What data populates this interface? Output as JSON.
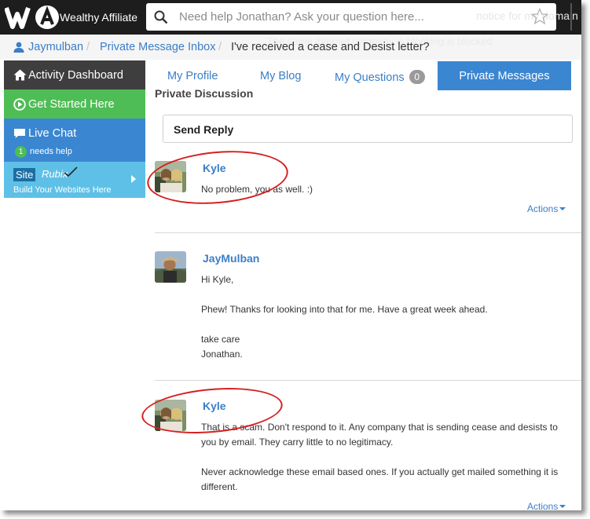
{
  "topbar": {
    "brand": "Wealthy Affiliate",
    "search_placeholder": "Need help Jonathan? Ask your question here...",
    "ghost_text": "notice for my domain"
  },
  "breadcrumb": {
    "user": "Jaymulban",
    "separator": "/",
    "inbox": "Private Message Inbox",
    "current": "I've received a cease and Desist letter?",
    "ghost_text": "The same internet company is blocking is blocked"
  },
  "sidebar": {
    "items": [
      {
        "label": "Activity Dashboard",
        "icon": "home-icon",
        "color": "#3e3e3e"
      },
      {
        "label": "Get Started Here",
        "icon": "play-circle-icon",
        "color": "#4fbd55"
      },
      {
        "label": "Live Chat",
        "icon": "chat-icon",
        "color": "#3b86d1",
        "badge": "1",
        "sub": "needs help"
      },
      {
        "label_box": "Site",
        "label_text": "Rubix",
        "sub": "Build Your Websites Here",
        "color": "#5ec0e6"
      }
    ]
  },
  "tabs": [
    {
      "label": "My Profile"
    },
    {
      "label": "My Blog"
    },
    {
      "label": "My Questions",
      "badge": "0"
    },
    {
      "label": "Private Messages",
      "active": true
    }
  ],
  "main": {
    "section_title": "Private Discussion",
    "reply_label": "Send Reply",
    "actions_label": "Actions",
    "messages": [
      {
        "author": "Kyle",
        "lines": [
          "No problem, you as well. :)"
        ]
      },
      {
        "author": "JayMulban",
        "lines": [
          "Hi Kyle,",
          "Phew! Thanks for looking into that for me. Have a great week ahead.",
          "take care",
          "Jonathan."
        ]
      },
      {
        "author": "Kyle",
        "lines": [
          "That is a scam. Don't respond to it. Any company that is sending cease and desists to",
          "you by email. They carry little to no legitimacy.",
          "Never acknowledge these email based ones. If you actually get mailed something it is",
          "different."
        ]
      }
    ]
  },
  "colors": {
    "link": "#3b7ec7",
    "active_tab": "#3b86d1",
    "annotation": "#d62020"
  }
}
